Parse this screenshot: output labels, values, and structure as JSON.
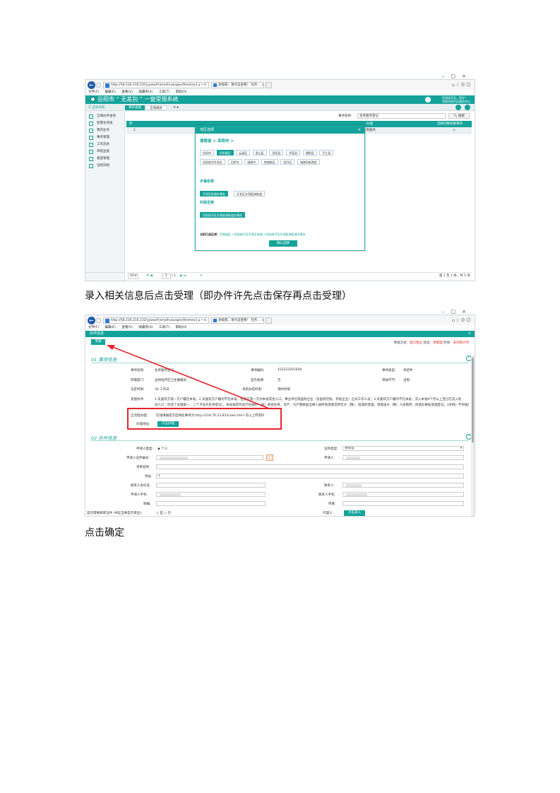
{
  "window_controls": [
    "–",
    "□",
    "×"
  ],
  "ie": {
    "address": "http://58.230.216.232/yyww/frame/hu/pages/themes/j",
    "address_icons": "ρ • ↻",
    "tab_title": "县级部，请点击查看！ 任务... ×",
    "right_icons": "⌂☆⚙☺",
    "menu": [
      "文件(F)",
      "编辑(E)",
      "查看(V)",
      "收藏夹(A)",
      "工具(T)",
      "帮助(H)"
    ]
  },
  "app": {
    "title": "岳阳市 “ 无差别 ” 一窗受理系统",
    "user_line1": "岳阳经开区，您好！",
    "user_line2": "岳阳市经开区政务中心",
    "nav_label": "☰ 全局导航",
    "tab_home": "我的桌面",
    "tab_active": "全域通办",
    "tab_close": "× ▸"
  },
  "sidebar": {
    "items": [
      "全域办件查询",
      "智慧化考核",
      "我的业务",
      "事务管理",
      "工作流办",
      "审批监督",
      "督查管理",
      "证照归档"
    ]
  },
  "search": {
    "label": "事项名称:",
    "value": "生育服务登记",
    "button": "🔍 搜索"
  },
  "table": {
    "headers": [
      "序",
      "",
      "办理",
      "选择切换关联事项"
    ],
    "row": [
      "1",
      "",
      "生育服务",
      "◎"
    ]
  },
  "pager": {
    "size": "10 ▾",
    "nav": "⏮ ◀",
    "page": "1",
    "of": "/ 1",
    "nav2": "▶ ⏭",
    "refresh": "↻",
    "summary": "第 1 至 1 条，共 1 条"
  },
  "modal": {
    "title": "地区选择",
    "close": "×",
    "breadcrumb": "湖南省 > 岳阳市 >",
    "districts": [
      "岳阳市",
      "岳阳楼区",
      "云溪区",
      "君山区",
      "岳阳县",
      "华容县",
      "湘阴县",
      "平江县",
      "岳阳经济开发区",
      "汨罗市",
      "临湘市",
      "南湖新区",
      "经开区",
      "城陵矶新港区"
    ],
    "selected_district": "岳阳楼区",
    "town_label": "乡镇名称",
    "towns": [
      "开发区街道办事处",
      "开发区东洞庭湖街道"
    ],
    "village_label": "村组名称",
    "village": "岳阳经开区东洞庭湖街道办事处",
    "current_label": "当前已选区域：",
    "current_value": "岳阳楼区->岳阳经开区开发区街道->岳阳经开区东洞庭湖街道办事处",
    "confirm": "确认选择"
  },
  "caption1": "录入相关信息后点击受理（即办件许先点击保存再点击受理）",
  "caption2": "点击确定",
  "form": {
    "title": "办件信息",
    "close": "×",
    "accept": "受理",
    "status_label": "审批方式：",
    "status_red": "窗口登记",
    "status_mid": " 状态：",
    "status_state": "待受理",
    "status_mid2": " 时效：",
    "status_time": "未开始计时",
    "section1": "01 事项信息",
    "section2": "02 办件信息",
    "toggle": "⌃",
    "fields": {
      "item_name_label": "事项名称:",
      "item_name": "生育服务登记",
      "item_code_label": "事项编码:",
      "item_code": "432323201600",
      "item_type_label": "事项类型:",
      "item_type": "承诺件",
      "dept_label": "所属部门:",
      "dept": "岳阳经开区卫生健康局",
      "fee_label": "是否收费:",
      "fee": "否",
      "review_label": "审核环节:",
      "review": "证照",
      "limit_label": "法定时限:",
      "limit": "30 工作日",
      "promise_label": "承诺办结时限:",
      "promise": "预约时限",
      "cond_label": "受理条件:",
      "cond_text_1": "1.夫妻双方或一方户籍在本省；2.夫妻双方户籍均不在本省，但双方或一方为本省常住人口，事业单位或国有企业（含国有控股、参股企业）正式工作人员；3.夫妻双方户籍均不在本省，流入本省6个月以上且已在流入地",
      "cond_text_2": "动人口（包括了办理第一、二个子女的生育登记）。本省规定的孕产妇由村（居）委会生育、流产、引产需要由当事人居所地或者其所在乡（镇）、街道的受理，或者由乡（镇）人民政府、街道办事处受理登记。《条例》不作规定的，按国家有关规定执行。",
      "online_label": "全流程办理:",
      "online_value": "在线填报提交后将此事项为:http://218.76.23.85/index.html 可以上传资料",
      "addr_label": "办理地址:",
      "addr_btn": "点击办理",
      "applicant_type_label": "申请人类型:",
      "applicant_type": "◉ 个人",
      "cert_type_label": "证件类型:",
      "cert_type": "身份证",
      "cert_no_label": "申请人证件编号:",
      "applicant_label": "申请人:",
      "company_label": "项目名称:",
      "addr2_label": "地址:",
      "addr2": "1",
      "contact_id_label": "联系人身份证:",
      "contact_label": "联系人:",
      "phone_label": "申请人手机:",
      "contact_phone_label": "联系人手机:",
      "email_label": "邮编:",
      "fax_label": "传真:",
      "mail_q_label": "是否需要邮寄证件 (书证当事是否寄出):",
      "mail_q": "○ 是 ○ 否",
      "agent_label": "代理人:",
      "agent_btn": "点击录入"
    }
  },
  "colors": {
    "teal": "#14a39a",
    "red_box": "#e8232b"
  }
}
